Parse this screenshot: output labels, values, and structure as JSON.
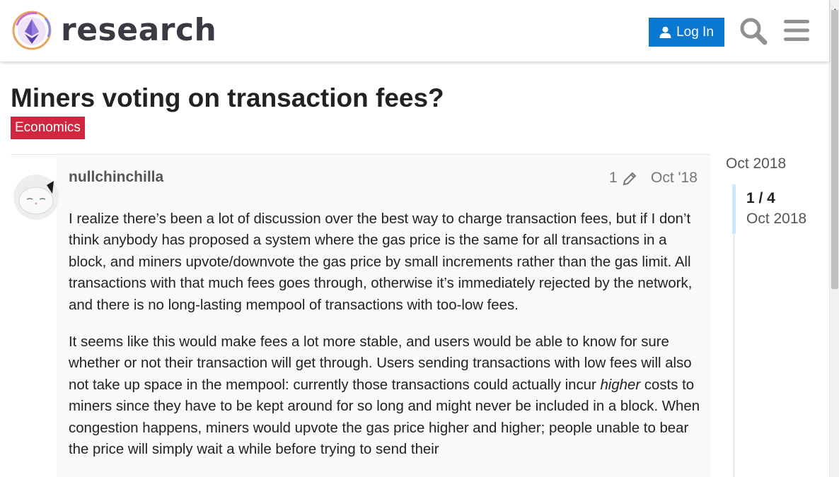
{
  "header": {
    "site_name": "research",
    "login_label": "Log In",
    "search_icon": "search-icon",
    "menu_icon": "hamburger-menu-icon"
  },
  "topic": {
    "title": "Miners voting on transaction fees?",
    "category": "Economics",
    "category_color": "#d1263f"
  },
  "post": {
    "username": "nullchinchilla",
    "edit_count": "1",
    "date": "Oct '18",
    "paragraph_1": "I realize there’s been a lot of discussion over the best way to charge transaction fees, but if I don’t think anybody has proposed a system where the gas price is the same for all transactions in a block, and miners upvote/downvote the gas price by small increments rather than the gas limit. All transactions with that much fees goes through, otherwise it’s immediately rejected by the network, and there is no long-lasting mempool of transactions with too-low fees.",
    "paragraph_2_before": "It seems like this would make fees a lot more stable, and users would be able to know for sure whether or not their transaction will get through. Users sending transactions with low fees will also not take up space in the mempool: currently those transactions could actually incur ",
    "paragraph_2_emphasis": "higher",
    "paragraph_2_after": " costs to miners since they have to be kept around for so long and might never be included in a block. When congestion happens, miners would upvote the gas price higher and higher; people unable to bear the price will simply wait a while before trying to send their"
  },
  "timeline": {
    "top_date": "Oct 2018",
    "position": "1 / 4",
    "current_date": "Oct 2018"
  },
  "colors": {
    "accent": "#0a77d1",
    "category": "#d1263f",
    "timeline_handle": "#cfe6f6"
  }
}
